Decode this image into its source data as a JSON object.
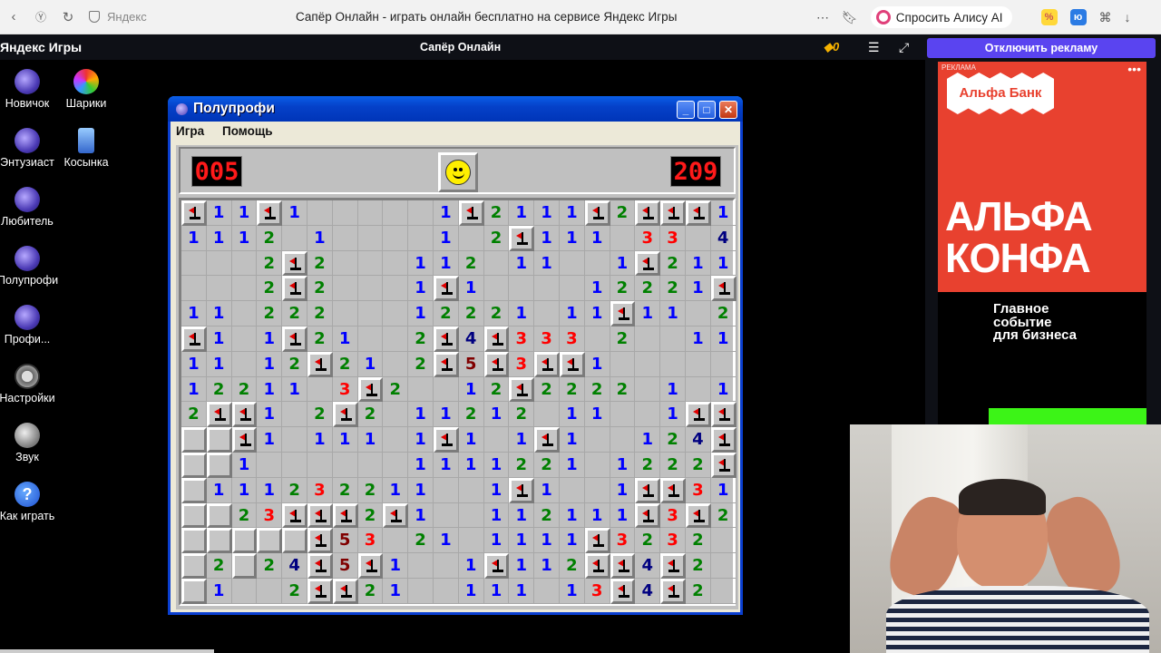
{
  "browser": {
    "address": "Яндекс",
    "tab_title": "Сапёр Онлайн - играть онлайн бесплатно на сервисе Яндекс Игры",
    "alice": "Спросить Алису AI"
  },
  "games_header": {
    "logo": "Яндекс Игры",
    "game_name": "Сапёр Онлайн",
    "coins": "0",
    "disable_ads": "Отключить рекламу"
  },
  "desktop_icons": [
    {
      "label": "Новичок"
    },
    {
      "label": "Шарики"
    },
    {
      "label": "Энтузиаст"
    },
    {
      "label": "Косынка"
    },
    {
      "label": "Любитель"
    },
    {
      "label": "Полупрофи"
    },
    {
      "label": "Профи..."
    },
    {
      "label": "Настройки"
    },
    {
      "label": "Звук"
    },
    {
      "label": "Как играть"
    }
  ],
  "window": {
    "title": "Полупрофи",
    "menu_game": "Игра",
    "menu_help": "Помощь",
    "mines_counter": "005",
    "timer": "209"
  },
  "board": [
    "F11F1     1F2111F2FFF1 ",
    "1112 1    1 2F111 33 4 21 ",
    "   2F2   112 11  1F211 ",
    "   2F2   1F1    12221F21",
    "11 222   12221 11F11 2F1",
    "F1 1F21  2F4F333 2  111",
    "11 12F21 2F5F3FF1",
    "12211 3F2  12F2222 1 1232",
    "2FF1 2F2 11212 11  1FFF",
    "HHF1 111 1F1 1F1  124F",
    "HH1      1111221 1222F",
    "H111232211  1F1  1FF31",
    "HH23FFF2F1  112111F3F2 ",
    "HHHHHF53 21 1111F3232 ",
    "H2H24F5F1  1F112FF4F2 ",
    "H1  2FF21  111 13F4F2 "
  ],
  "ad": {
    "label": "РЕКЛАМА",
    "bank": "Альфа Банк",
    "headline_1": "АЛЬФА",
    "headline_2": "КОНФА",
    "sub_1": "Главное",
    "sub_2": "событие",
    "sub_3": "для бизнеса"
  }
}
